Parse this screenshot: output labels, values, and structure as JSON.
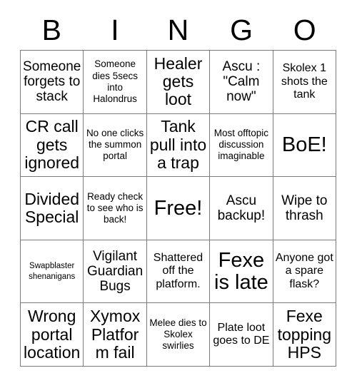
{
  "header": {
    "letters": [
      "B",
      "I",
      "N",
      "G",
      "O"
    ]
  },
  "grid": {
    "rows": 5,
    "columns": 5,
    "line_color": "#7a7a7a",
    "background_color": "#ffffff",
    "text_color": "#000000",
    "cells": [
      {
        "text": "Someone forgets to stack",
        "size": "lg"
      },
      {
        "text": "Someone dies 5secs into Halondrus",
        "size": "sm"
      },
      {
        "text": "Healer gets loot",
        "size": "xl"
      },
      {
        "text": "Ascu : \"Calm now\"",
        "size": "lg"
      },
      {
        "text": "Skolex 1 shots the tank",
        "size": "md"
      },
      {
        "text": "CR call gets ignored",
        "size": "xl"
      },
      {
        "text": "No one clicks the summon portal",
        "size": "sm"
      },
      {
        "text": "Tank pull into a trap",
        "size": "xl"
      },
      {
        "text": "Most offtopic discussion imaginable",
        "size": "sm"
      },
      {
        "text": "BoE!",
        "size": "xxl"
      },
      {
        "text": "Divided Special",
        "size": "xl"
      },
      {
        "text": "Ready check to see who is back!",
        "size": "sm"
      },
      {
        "text": "Free!",
        "size": "xxl"
      },
      {
        "text": "Ascu backup!",
        "size": "lg"
      },
      {
        "text": "Wipe to thrash",
        "size": "lg"
      },
      {
        "text": "Swapblaster shenanigans",
        "size": "xs"
      },
      {
        "text": "Vigilant Guardian Bugs",
        "size": "lg"
      },
      {
        "text": "Shattered off the platform.",
        "size": "md"
      },
      {
        "text": "Fexe is late",
        "size": "xxl"
      },
      {
        "text": "Anyone got a spare flask?",
        "size": "md"
      },
      {
        "text": "Wrong portal location",
        "size": "xl"
      },
      {
        "text": "Xymox Platform fail",
        "size": "xl"
      },
      {
        "text": "Melee dies to Skolex swirlies",
        "size": "sm"
      },
      {
        "text": "Plate loot goes to DE",
        "size": "md"
      },
      {
        "text": "Fexe topping HPS",
        "size": "xl"
      }
    ]
  }
}
